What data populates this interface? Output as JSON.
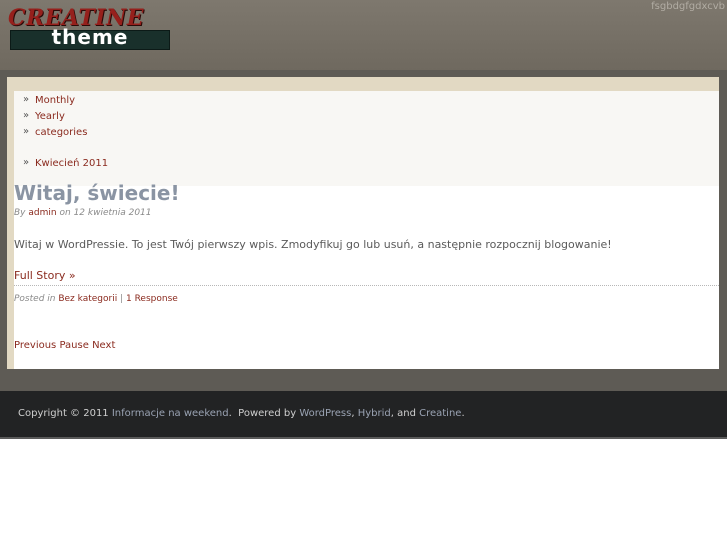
{
  "header": {
    "logo_top": "CREATINE",
    "logo_bottom": "theme",
    "tagline": "fsgbdgfgdxcvb"
  },
  "widgets": {
    "items": [
      {
        "label": "Monthly"
      },
      {
        "label": "Yearly"
      },
      {
        "label": "categories"
      },
      {
        "label": "Kwiecień 2011"
      }
    ]
  },
  "post": {
    "title": "Witaj, świecie!",
    "by_label": "By",
    "author": "admin",
    "on_label": "on",
    "date": "12 kwietnia 2011",
    "excerpt": "Witaj w WordPressie. To jest Twój pierwszy wpis. Zmodyfikuj go lub usuń, a następnie rozpocznij blogowanie!",
    "full_story": "Full Story »",
    "posted_in_label": "Posted in",
    "category": "Bez kategorii",
    "separator": "|",
    "responses": "1 Response"
  },
  "navigation": {
    "previous": "Previous",
    "pause": "Pause",
    "next": "Next"
  },
  "footer": {
    "copyright": "Copyright © 2011",
    "site_name": "Informacje na weekend",
    "period": ".",
    "powered_by": "Powered by",
    "wordpress": "WordPress",
    "comma": ",",
    "hybrid": "Hybrid",
    "and": ", and",
    "creatine": "Creatine",
    "end": "."
  }
}
